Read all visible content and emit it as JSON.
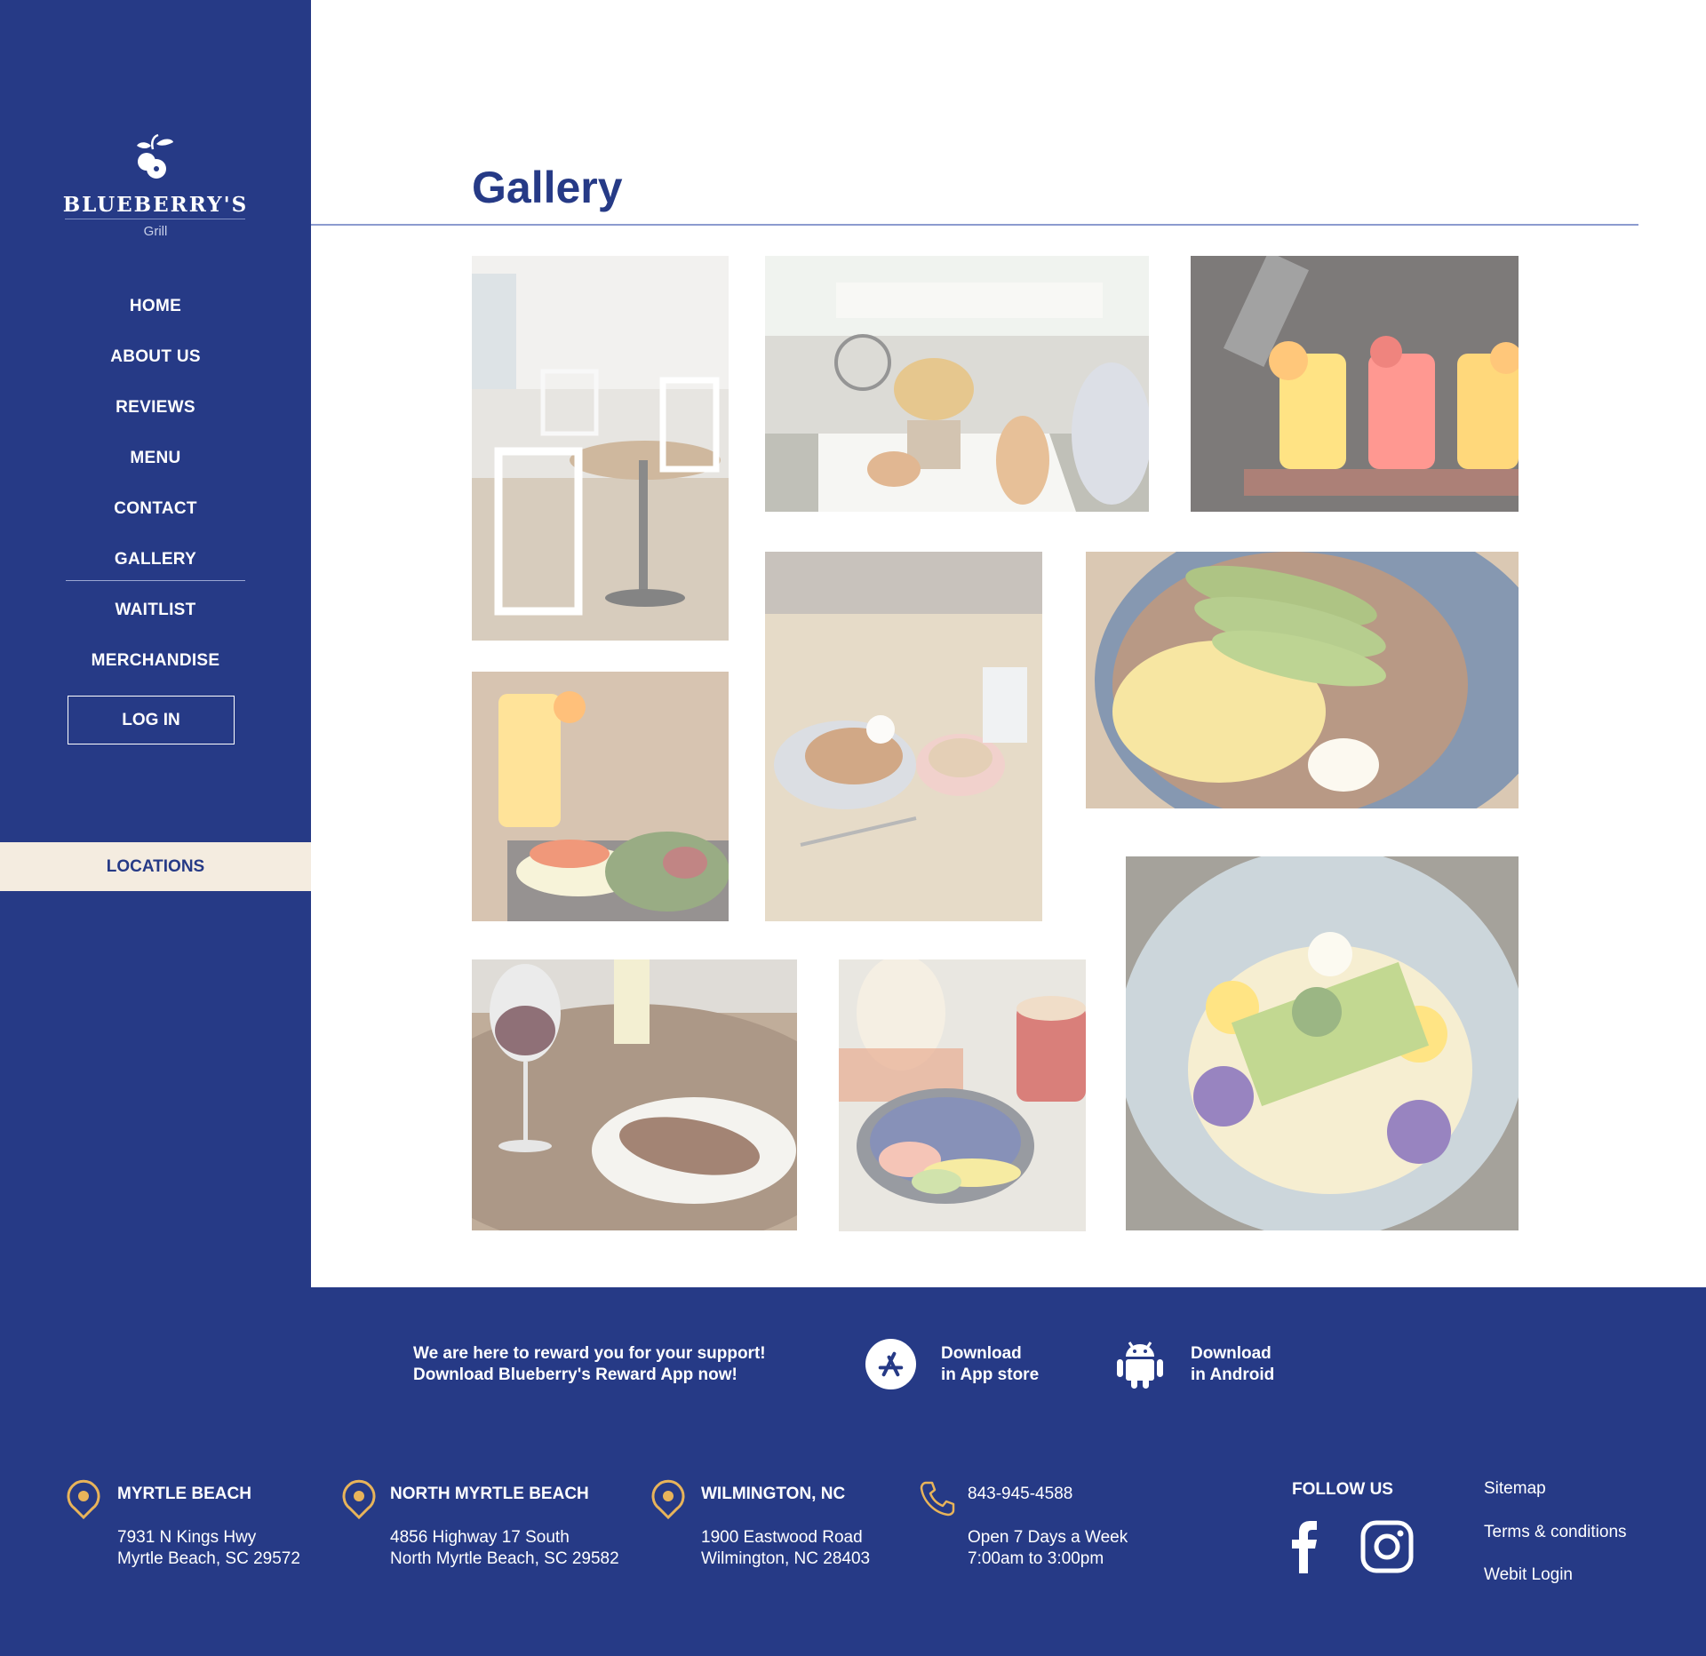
{
  "brand": {
    "name": "BLUEBERRY'S",
    "sub": "Grill"
  },
  "nav": {
    "items": [
      "HOME",
      "ABOUT US",
      "REVIEWS",
      "MENU",
      "CONTACT",
      "GALLERY",
      "WAITLIST",
      "MERCHANDISE"
    ],
    "active": "GALLERY",
    "login_label": "LOG IN",
    "locations_label": "LOCATIONS"
  },
  "page": {
    "title": "Gallery"
  },
  "gallery": {
    "photos": [
      "restaurant-interior",
      "patio-autumn-decor",
      "drink-flight",
      "smoothie-and-salmon-plate",
      "french-toast-and-latte",
      "avocado-benedict",
      "wine-and-steak",
      "fruit-bowl-and-latte",
      "hash-with-cucumber"
    ]
  },
  "footer": {
    "promo_line1": "We are here to reward you for your support!",
    "promo_line2": "Download Blueberry's Reward App now!",
    "appstore_line1": "Download",
    "appstore_line2": "in App store",
    "android_line1": "Download",
    "android_line2": "in Android",
    "locations": [
      {
        "name": "MYRTLE BEACH",
        "line1": "7931 N Kings Hwy",
        "line2": "Myrtle Beach, SC 29572"
      },
      {
        "name": "NORTH MYRTLE BEACH",
        "line1": "4856 Highway 17 South",
        "line2": "North Myrtle Beach, SC 29582"
      },
      {
        "name": "WILMINGTON, NC",
        "line1": "1900 Eastwood Road",
        "line2": "Wilmington, NC 28403"
      }
    ],
    "phone": "843-945-4588",
    "hours_line1": "Open 7 Days a Week",
    "hours_line2": "7:00am to 3:00pm",
    "follow_label": "FOLLOW US",
    "links": [
      "Sitemap",
      "Terms & conditions",
      "Webit Login"
    ]
  },
  "colors": {
    "navy": "#263a86",
    "cream": "#f4ece0",
    "gold": "#e8b45a",
    "rule": "#8c9bcf"
  }
}
